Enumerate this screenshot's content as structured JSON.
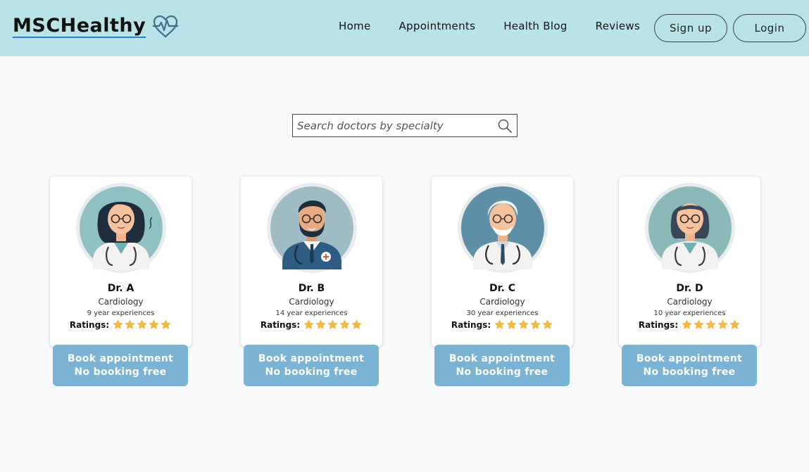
{
  "brand": {
    "name": "MSCHealthy",
    "icon": "heartbeat-icon"
  },
  "nav": {
    "home": "Home",
    "appointments": "Appointments",
    "blog": "Health Blog",
    "reviews": "Reviews"
  },
  "auth": {
    "signup": "Sign up",
    "login": "Login"
  },
  "search": {
    "placeholder": "Search doctors by specialty",
    "icon": "search-icon"
  },
  "doctors": [
    {
      "name": "Dr. A",
      "specialty": "Cardiology",
      "experience": "9 year experiences",
      "ratings_label": "Ratings:",
      "rating": 5
    },
    {
      "name": "Dr. B",
      "specialty": "Cardiology",
      "experience": "14 year experiences",
      "ratings_label": "Ratings:",
      "rating": 5
    },
    {
      "name": "Dr. C",
      "specialty": "Cardiology",
      "experience": "30 year experiences",
      "ratings_label": "Ratings:",
      "rating": 5
    },
    {
      "name": "Dr. D",
      "specialty": "Cardiology",
      "experience": "10 year experiences",
      "ratings_label": "Ratings:",
      "rating": 5
    }
  ],
  "booking": {
    "line1": "Book appointment",
    "line2": "No booking free"
  },
  "colors": {
    "header": "#bae3e7",
    "button": "#7ab3d4",
    "star": "#f4b740",
    "background": "#f8f9fb",
    "accent": "#2b7fd6"
  }
}
